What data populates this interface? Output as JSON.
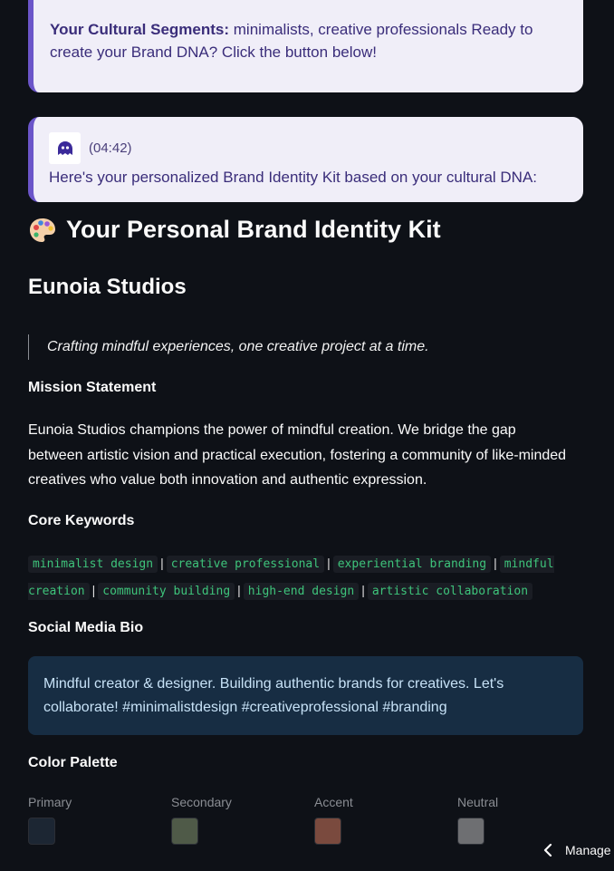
{
  "messages": {
    "segments_label": "Your Cultural Segments:",
    "segments_text": " minimalists, creative professionals Ready to create your Brand DNA? Click the button below!",
    "assistant_timestamp": "(04:42)",
    "assistant_text": "Here's your personalized Brand Identity Kit based on your cultural DNA:"
  },
  "kit": {
    "heading": "Your Personal Brand Identity Kit",
    "heading_icon": "palette-icon",
    "brand_name": "Eunoia Studios",
    "tagline": "Crafting mindful experiences, one creative project at a time.",
    "mission_heading": "Mission Statement",
    "mission_text": "Eunoia Studios champions the power of mindful creation. We bridge the gap between artistic vision and practical execution, fostering a community of like-minded creatives who value both innovation and authentic expression.",
    "keywords_heading": "Core Keywords",
    "keywords": [
      "minimalist design",
      "creative professional",
      "experiential branding",
      "mindful creation",
      "community building",
      "high-end design",
      "artistic collaboration"
    ],
    "bio_heading": "Social Media Bio",
    "bio_text": "Mindful creator & designer. Building authentic brands for creatives. Let's collaborate! #minimalistdesign #creativeprofessional #branding",
    "palette_heading": "Color Palette",
    "palette": [
      {
        "label": "Primary",
        "color": "#1c2633"
      },
      {
        "label": "Secondary",
        "color": "#4f5a48"
      },
      {
        "label": "Accent",
        "color": "#7a4a3e"
      },
      {
        "label": "Neutral",
        "color": "#6e6f72"
      }
    ]
  },
  "footer": {
    "manage_label": "Manage app"
  },
  "colors": {
    "background": "#0e1117",
    "message_bg": "#f0eef8",
    "message_accent": "#6b55c9",
    "keyword_text": "#3ec47b",
    "bio_bg": "#172d43"
  }
}
